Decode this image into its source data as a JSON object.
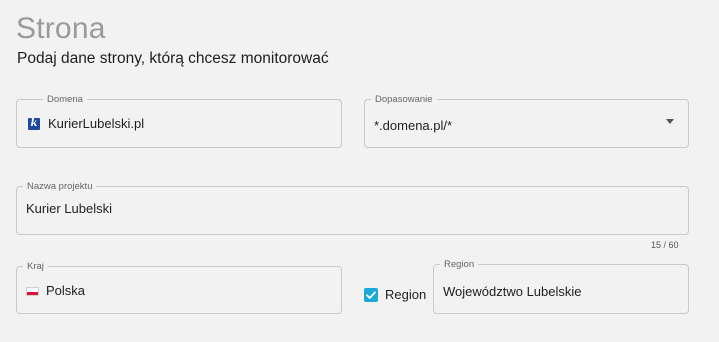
{
  "header": {
    "title": "Strona",
    "subtitle": "Podaj dane strony, którą chcesz monitorować"
  },
  "domain_field": {
    "label": "Domena",
    "value": "KurierLubelski.pl",
    "favicon_letter": "k"
  },
  "match_field": {
    "label": "Dopasowanie",
    "value": "*.domena.pl/*"
  },
  "project_field": {
    "label": "Nazwa projektu",
    "value": "Kurier Lubelski",
    "counter": "15 / 60"
  },
  "country_field": {
    "label": "Kraj",
    "value": "Polska",
    "flag_icon": "poland-flag-icon"
  },
  "region_checkbox": {
    "label": "Region",
    "checked": true,
    "color": "#1aa9d6"
  },
  "region_field": {
    "label": "Region",
    "value": "Województwo Lubelskie"
  }
}
